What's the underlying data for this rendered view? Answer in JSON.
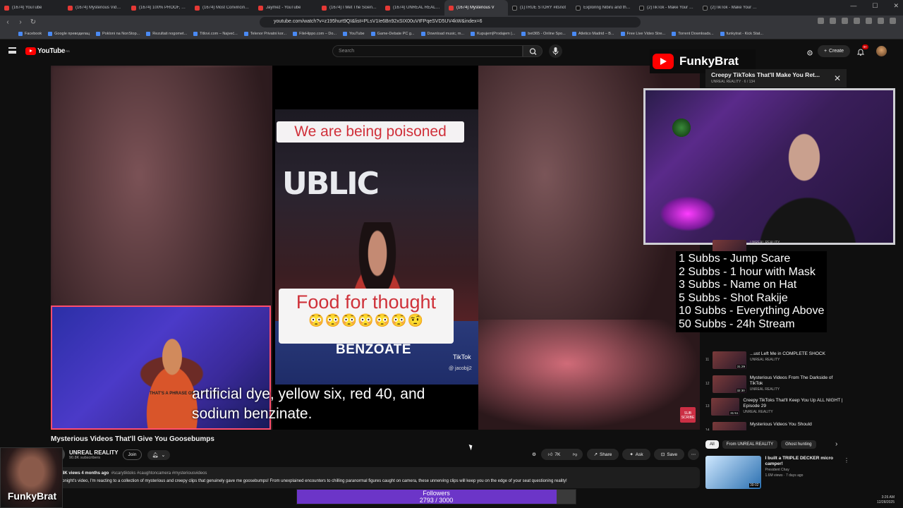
{
  "browser": {
    "tabs": [
      {
        "label": "(1674) YouTube",
        "icon": "youtube"
      },
      {
        "label": "(1674) Mysterious Videos",
        "icon": "youtube"
      },
      {
        "label": "(1674) 100% PROOF, PARA",
        "icon": "youtube"
      },
      {
        "label": "(1674) Most Convincing Ev",
        "icon": "youtube"
      },
      {
        "label": "Jaymez - YouTube",
        "icon": "youtube"
      },
      {
        "label": "(1674) I Met The Scientist",
        "icon": "youtube"
      },
      {
        "label": "(1674) UNREAL REALITY",
        "icon": "youtube"
      },
      {
        "label": "(1674) Mysterious V",
        "icon": "youtube",
        "active": true
      },
      {
        "label": "(1)TRUE STORY #itsnot",
        "icon": "tiktok"
      },
      {
        "label": "Exploring Nibiru and the N",
        "icon": "tiktok"
      },
      {
        "label": "(2)TikTok - Make Your Day",
        "icon": "tiktok"
      },
      {
        "label": "(2)TikTok - Make Your Day",
        "icon": "tiktok"
      }
    ],
    "url": "youtube.com/watch?v=z195hurt9QI&list=PLsV1Ie6Bn92xSIX00uVtFPqeSVD5UV4kW&index=6",
    "bookmarks": [
      "Facebook",
      "Google преводилац",
      "Poklonі na NonStop...",
      "Rezultati nogomet...",
      "Titlovi.com – Najveć...",
      "Telenor Privatni kor...",
      "FileHippo.com – Do...",
      "YouTube",
      "Game-Debate PC g...",
      "Download music, m...",
      "Kupujem|Prodajem |...",
      "bet365 - Online Spo...",
      "Atletico Madrid – B...",
      "Free Live Video Stre...",
      "Torrent Downloads...",
      "funkytrat - Kick Stat..."
    ]
  },
  "youtube": {
    "logo_text": "YouTube",
    "logo_region": "RS",
    "search_placeholder": "Search",
    "create_label": "Create",
    "notif_count": "9+"
  },
  "video": {
    "tiktok_caption_top": "We are being poisoned",
    "tiktok_bg_text": "UBLIC",
    "tiktok_caption_mid": "Food for thought",
    "tiktok_emojis": "😳😳😳😳😳😳🤨",
    "tiktok_caption_bottom": "BENZOATE",
    "tiktok_brand": "TikTok",
    "tiktok_user": "@ jacobjj2",
    "subtitle_line1": "artificial dye, yellow six, red 40, and",
    "subtitle_line2": "sodium benzinate.",
    "streamer_shirt": "THAT'S A PHRASE OF COUR BYRE",
    "sub_stamp": "SUB SCRIBE"
  },
  "stream_overlay": {
    "brand": "FunkyBrat",
    "miniplayer_title": "Creepy TikToks That'll Make You Ret...",
    "miniplayer_sub": "UNREAL REALITY · 6 / 134",
    "rewards": [
      "1 Subbs - Jump Scare",
      "2 Subbs - 1 hour with Mask",
      "3 Subbs - Name on Hat",
      "5 Subbs - Shot Rakije",
      "10 Subbs - Everything Above",
      "50 Subbs - 24h Stream"
    ],
    "bottom_brand": "FunkyBrat",
    "followers_label": "Followers",
    "followers_current": 2793,
    "followers_goal": 3000,
    "followers_text": "2793 / 3000"
  },
  "playlist": {
    "items": [
      {
        "num": "",
        "title": "",
        "channel": "UNREAL REALITY",
        "duration": ""
      },
      {
        "num": "11",
        "title": "...ust Left Me in COMPLETE SHOCK",
        "channel": "UNREAL REALITY",
        "duration": "31:29"
      },
      {
        "num": "12",
        "title": "Mysterious Videos From The Darkside of TikTok",
        "channel": "UNREAL REALITY",
        "duration": "32:30"
      },
      {
        "num": "13",
        "title": "Creepy TikToks That'll Keep You Up ALL NIGHT | Episode 29",
        "channel": "UNREAL REALITY",
        "duration": "31:51"
      },
      {
        "num": "14",
        "title": "Mysterious Videos You Should",
        "channel": "",
        "duration": ""
      }
    ]
  },
  "chips": [
    "All",
    "From UNREAL REALITY",
    "Ghost hunting"
  ],
  "next_rec": {
    "title": "I built a TRIPLE DECKER micro camper!",
    "channel": "President Chay",
    "meta": "1.6M views · 7 days ago",
    "duration": "39:02"
  },
  "watch": {
    "title": "Mysterious Videos That'll Give You Goosebumps",
    "channel": "UNREAL REALITY",
    "subscribers": "90.8K subscribers",
    "join_label": "Join",
    "likes": "7K",
    "share_label": "Share",
    "ask_label": "Ask",
    "save_label": "Save",
    "desc_meta": "8K views  4 months ago",
    "desc_tags": "#scarytiktoks #caughtoncamera #mysteriousvideos",
    "desc_text": "onight's video, I'm reacting to a collection of mysterious and creepy clips that genuinely gave me goosebumps! From unexplained encounters to chilling paranormal figures caught on camera, these unnerving clips will keep you on the edge of your seat questioning reality!"
  },
  "taskbar": {
    "time": "3:26 AM",
    "date": "12/28/2025"
  }
}
